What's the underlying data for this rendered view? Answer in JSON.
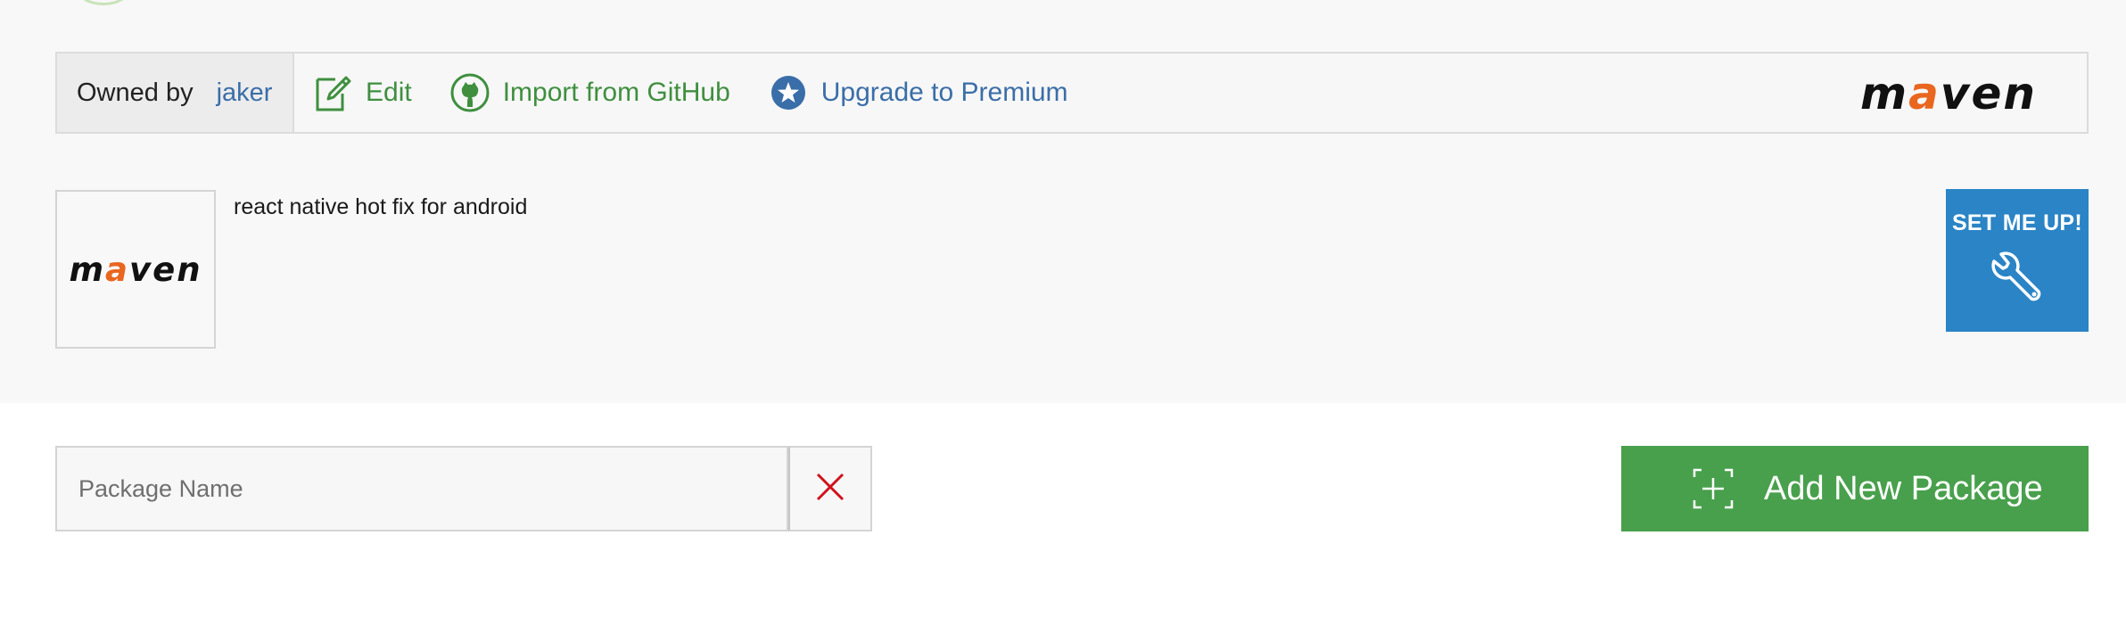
{
  "toolbar": {
    "owned_by_label": "Owned by",
    "owner": "jaker",
    "edit_label": "Edit",
    "import_label": "Import from GitHub",
    "premium_label": "Upgrade to Premium",
    "logo_text": {
      "before": "m",
      "accent": "a",
      "after": "ven"
    }
  },
  "repo": {
    "logo_text": {
      "before": "m",
      "accent": "a",
      "after": "ven"
    },
    "description": "react native hot fix for android",
    "setup_label": "SET ME UP!"
  },
  "search": {
    "placeholder": "Package Name",
    "value": ""
  },
  "actions": {
    "add_package_label": "Add New Package"
  },
  "colors": {
    "green": "#48a04c",
    "link_blue": "#3a6ea8",
    "setup_blue": "#2a84c6",
    "maven_accent": "#e9661f",
    "clear_red": "#d0111b"
  },
  "icons": {
    "edit": "edit-icon",
    "github": "github-icon",
    "premium": "star-icon",
    "setup": "wrench-icon",
    "clear": "close-icon",
    "add": "plus-icon"
  }
}
